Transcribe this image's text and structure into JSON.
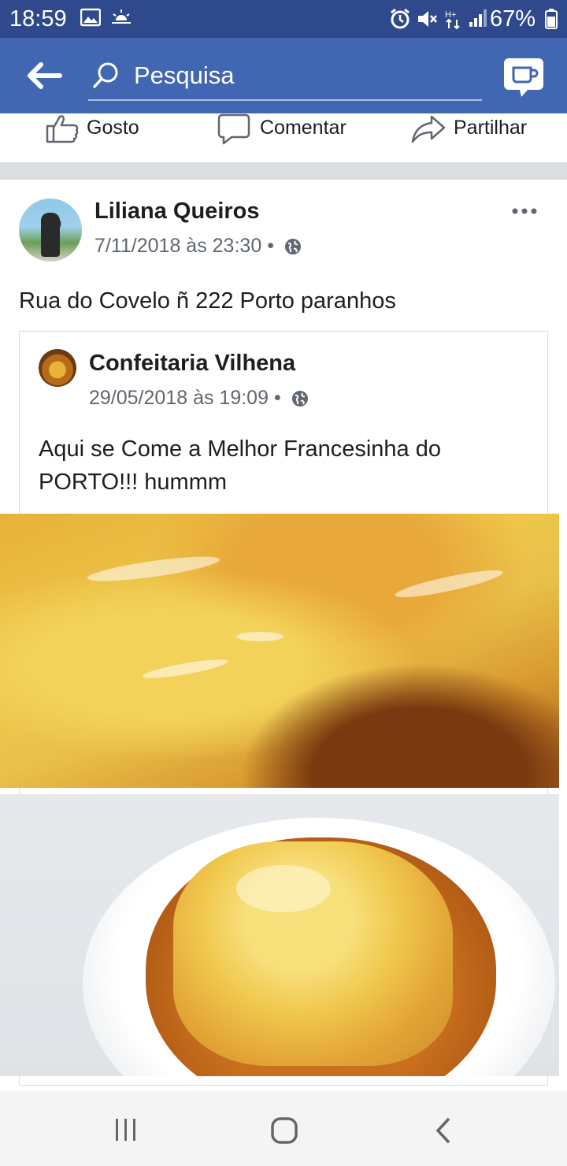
{
  "status_bar": {
    "time": "18:59",
    "battery": "67%",
    "icons": [
      "gallery-icon",
      "weather-icon",
      "alarm-icon",
      "mute-icon",
      "data-icon",
      "signal-icon",
      "battery-icon"
    ]
  },
  "header": {
    "search_placeholder": "Pesquisa",
    "accent_color": "#4267b2",
    "icons": [
      "back-arrow-icon",
      "search-icon",
      "messenger-icon"
    ]
  },
  "actions": {
    "like_label": "Gosto",
    "comment_label": "Comentar",
    "share_label": "Partilhar"
  },
  "post": {
    "author": "Liliana Queiros",
    "timestamp": "7/11/2018 às 23:30",
    "separator": "•",
    "text": "Rua do Covelo ñ 222 Porto paranhos",
    "shared": {
      "page_name": "Confeitaria Vilhena",
      "timestamp": "29/05/2018 às 19:09",
      "separator": "•",
      "text": "Aqui se Come a Melhor Francesinha do PORTO!!! hummm"
    }
  },
  "navbar": {
    "icons": [
      "recents-icon",
      "home-icon",
      "back-icon"
    ]
  }
}
